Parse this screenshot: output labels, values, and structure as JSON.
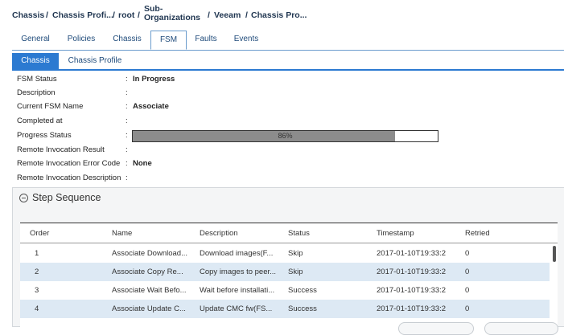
{
  "breadcrumb": {
    "chassis": "Chassis",
    "chassis_profiles": "Chassis Profi...",
    "root": "root",
    "sub_orgs_line1": "Sub-",
    "sub_orgs_line2": "Organizations",
    "veeam": "Veeam",
    "chassis_profile": "Chassis Pro..."
  },
  "tabs": [
    "General",
    "Policies",
    "Chassis",
    "FSM",
    "Faults",
    "Events"
  ],
  "active_tab": "FSM",
  "subtabs": [
    "Chassis",
    "Chassis Profile"
  ],
  "active_subtab": "Chassis",
  "properties": {
    "fsm_status": {
      "label": "FSM Status",
      "value": "In Progress"
    },
    "description": {
      "label": "Description",
      "value": ""
    },
    "current_fsm_name": {
      "label": "Current FSM Name",
      "value": "Associate"
    },
    "completed_at": {
      "label": "Completed at",
      "value": ""
    },
    "progress_status": {
      "label": "Progress Status",
      "value": "86%",
      "fraction": 0.86
    },
    "remote_invocation_result": {
      "label": "Remote Invocation Result",
      "value": ""
    },
    "remote_invocation_error_code": {
      "label": "Remote Invocation Error Code",
      "value": "None"
    },
    "remote_invocation_description": {
      "label": "Remote Invocation Description",
      "value": ""
    }
  },
  "step_sequence": {
    "title": "Step Sequence",
    "columns": [
      "Order",
      "Name",
      "Description",
      "Status",
      "Timestamp",
      "Retried"
    ],
    "rows": [
      [
        "1",
        "Associate Download...",
        "Download images(F...",
        "Skip",
        "2017-01-10T19:33:2",
        "0"
      ],
      [
        "2",
        "Associate Copy Re...",
        "Copy images to peer...",
        "Skip",
        "2017-01-10T19:33:2",
        "0"
      ],
      [
        "3",
        "Associate Wait Befo...",
        "Wait before installati...",
        "Success",
        "2017-01-10T19:33:2",
        "0"
      ],
      [
        "4",
        "Associate Update C...",
        "Update CMC fw(FS...",
        "Success",
        "2017-01-10T19:33:2",
        "0"
      ]
    ]
  },
  "colors": {
    "accent": "#2c7ad1",
    "tab_border": "#6b9ccd",
    "row_alt": "#dde9f4",
    "progress_fill": "#8c8c8c"
  },
  "icons": {
    "collapse": "minus-circle-icon"
  }
}
